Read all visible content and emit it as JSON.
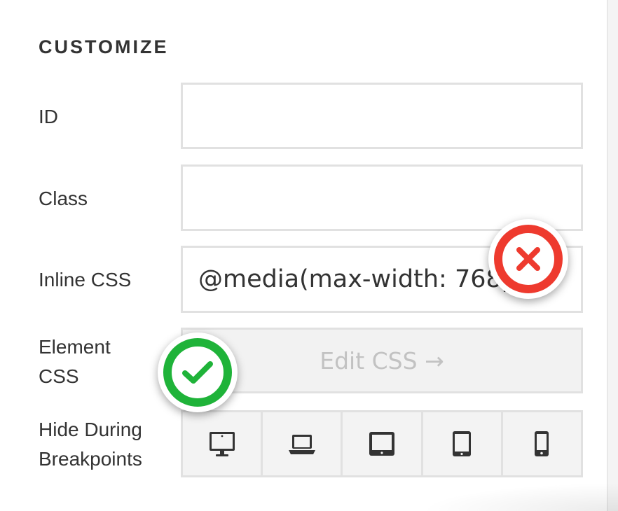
{
  "section": {
    "title": "CUSTOMIZE"
  },
  "fields": {
    "id": {
      "label": "ID",
      "value": ""
    },
    "class": {
      "label": "Class",
      "value": ""
    },
    "inline_css": {
      "label": "Inline CSS",
      "value": "@media(max-width: 768px)"
    }
  },
  "element_css": {
    "label_line1": "Element",
    "label_line2": "CSS",
    "button_label": "Edit CSS →"
  },
  "hide_breakpoints": {
    "label_line1": "Hide During",
    "label_line2": "Breakpoints",
    "icons": [
      "desktop-icon",
      "laptop-icon",
      "tablet-landscape-icon",
      "tablet-portrait-icon",
      "phone-icon"
    ]
  },
  "annotations": {
    "error_icon": "x-circle-icon",
    "error_color": "#ee3a2e",
    "success_icon": "check-circle-icon",
    "success_color": "#1fb339"
  },
  "colors": {
    "icon": "#333333",
    "border": "#e1e1e1",
    "disabled_text": "#c2c2c2"
  }
}
